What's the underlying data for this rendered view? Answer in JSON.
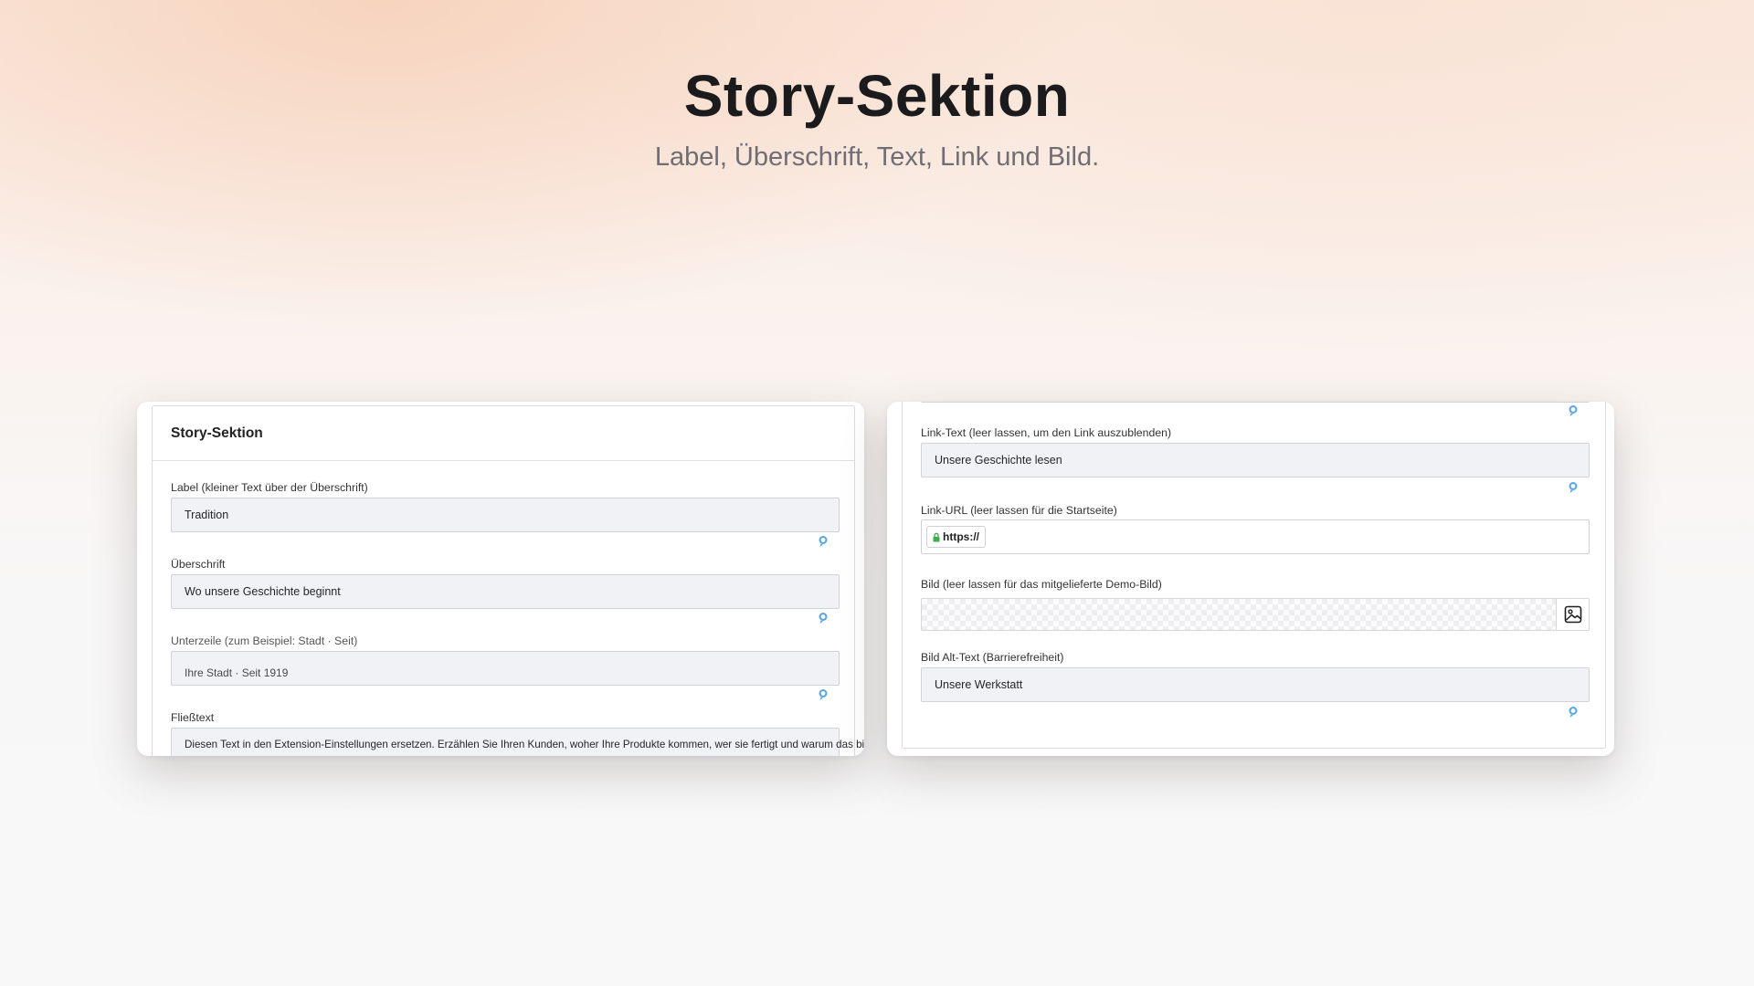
{
  "hero": {
    "title": "Story-Sektion",
    "subtitle": "Label, Überschrift, Text, Link und Bild."
  },
  "left_panel": {
    "header": "Story-Sektion",
    "fields": [
      {
        "label": "Label (kleiner Text über der Überschrift)",
        "value": "Tradition"
      },
      {
        "label": "Überschrift",
        "value": "Wo unsere Geschichte beginnt"
      },
      {
        "label": "Unterzeile (zum Beispiel: Stadt · Seit)",
        "value": "Ihre Stadt · Seit 1919"
      },
      {
        "label": "Fließtext",
        "value": "Diesen Text in den Extension-Einstellungen ersetzen. Erzählen Sie Ihren Kunden, woher Ihre Produkte kommen, wer sie fertigt und warum das bis heute"
      }
    ]
  },
  "right_panel": {
    "link_text": {
      "label": "Link-Text (leer lassen, um den Link auszublenden)",
      "value": "Unsere Geschichte lesen"
    },
    "link_url": {
      "label": "Link-URL (leer lassen für die Startseite)",
      "prefix": "https://",
      "value": ""
    },
    "image": {
      "label": "Bild (leer lassen für das mitgelieferte Demo-Bild)"
    },
    "image_alt": {
      "label": "Bild Alt-Text (Barrierefreiheit)",
      "value": "Unsere Werkstatt"
    }
  },
  "colors": {
    "translate_icon": "#5aa7e8",
    "lock_icon": "#3fae49"
  },
  "icons": {
    "translate": "translate-icon",
    "lock": "lock-icon",
    "image": "image-icon"
  }
}
